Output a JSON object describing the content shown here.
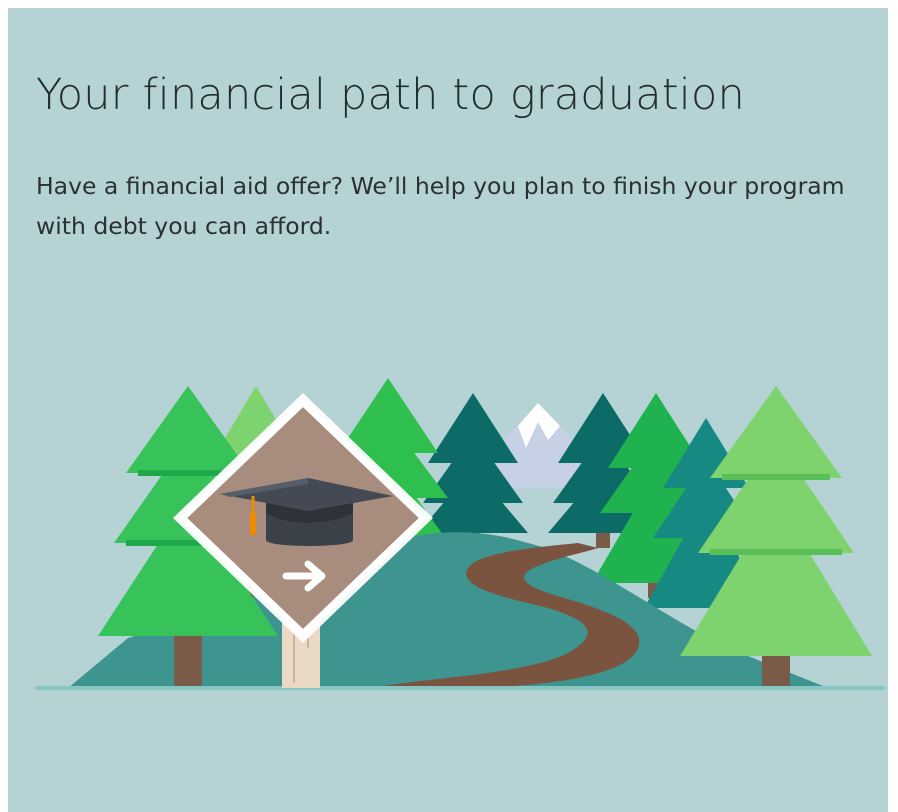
{
  "hero": {
    "title": "Your financial path to graduation",
    "subtitle": "Have a financial aid offer? We’ll help you plan to finish your program with debt you can afford."
  },
  "illustration": {
    "icons": [
      "pine-tree-icon",
      "mountain-icon",
      "path-icon",
      "road-sign-icon",
      "graduation-cap-icon",
      "arrow-right-icon"
    ]
  },
  "colors": {
    "background": "#b5d3d4",
    "text": "#232b30",
    "tree_light": "#7fd36f",
    "tree_green": "#38c25a",
    "tree_bright": "#1fb24f",
    "tree_dark": "#0c6b66",
    "tree_teal": "#168a82",
    "hill": "#3e9590",
    "path": "#7a543e",
    "sign": "#a88c7e",
    "mountain": "#c6d1e6"
  }
}
